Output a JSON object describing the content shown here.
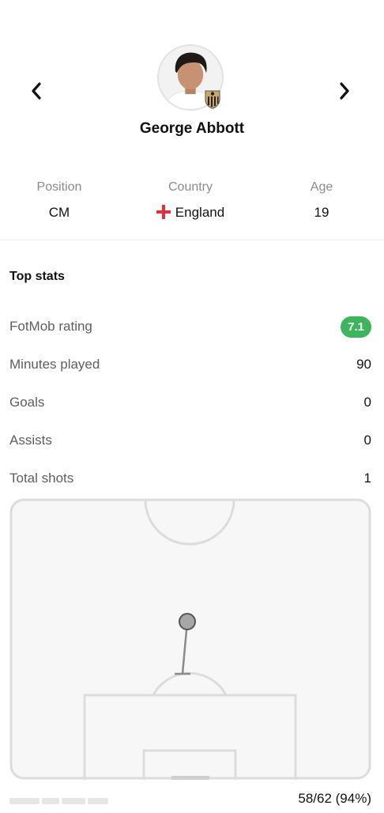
{
  "player": {
    "name": "George Abbott"
  },
  "info": {
    "position_label": "Position",
    "position_value": "CM",
    "country_label": "Country",
    "country_value": "England",
    "age_label": "Age",
    "age_value": "19"
  },
  "top_stats": {
    "title": "Top stats",
    "rows": [
      {
        "label": "FotMob rating",
        "value": "7.1"
      },
      {
        "label": "Minutes played",
        "value": "90"
      },
      {
        "label": "Goals",
        "value": "0"
      },
      {
        "label": "Assists",
        "value": "0"
      },
      {
        "label": "Total shots",
        "value": "1"
      }
    ]
  },
  "footer": {
    "value": "58/62 (94%)"
  },
  "colors": {
    "rating_green": "#3cb55c",
    "flag_red": "#e0323c",
    "pitch_line": "#dcdcdc",
    "pitch_fill": "#f7f7f7"
  },
  "icons": {
    "prev": "chevron-left-icon",
    "next": "chevron-right-icon",
    "flag": "england-flag-icon",
    "badge": "notts-county-badge-icon"
  }
}
